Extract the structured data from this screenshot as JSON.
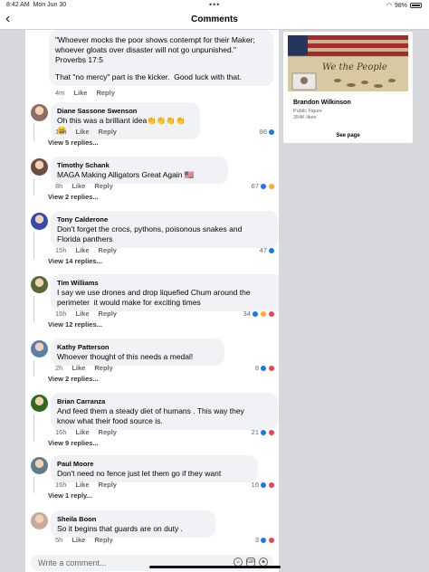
{
  "status_bar": {
    "time": "8:42 AM",
    "date": "Mon Jun 30",
    "battery": "98%"
  },
  "header": {
    "title": "Comments",
    "back_icon": "chevron-left-icon"
  },
  "top_comment": {
    "lines": [
      "\"Whoever mocks the poor shows contempt for their Maker;",
      "whoever gloats over disaster will not go unpunished.\"",
      "Proverbs 17:5",
      "",
      "That \"no mercy\" part is the kicker.  Good luck with that."
    ],
    "time": "4m",
    "like": "Like",
    "reply": "Reply"
  },
  "comments": [
    {
      "author": "Diane Sassone Swenson",
      "text": "Oh this was a brilliant idea👏👏👏👏😀",
      "time": "17h",
      "like": "Like",
      "reply": "Reply",
      "count": "86",
      "reactions": [
        "like"
      ],
      "replies": "View 5 replies...",
      "avatar_color": "#8d6e63"
    },
    {
      "author": "Timothy Schank",
      "text": "MAGA Making Alligators Great Again 🇺🇸",
      "time": "8h",
      "like": "Like",
      "reply": "Reply",
      "count": "67",
      "reactions": [
        "like",
        "haha"
      ],
      "replies": "View 2 replies...",
      "avatar_color": "#6d4c41"
    },
    {
      "author": "Tony Calderone",
      "text": "Don't forget the crocs, pythons, poisonous snakes and\nFlorida panthers",
      "time": "15h",
      "like": "Like",
      "reply": "Reply",
      "count": "47",
      "reactions": [
        "like"
      ],
      "replies": "View 14 replies...",
      "avatar_color": "#3949ab"
    },
    {
      "author": "Tim Williams",
      "text": "I say we use drones and drop liquefied Chum around the\nperimeter  it would make for exciting times",
      "time": "16h",
      "like": "Like",
      "reply": "Reply",
      "count": "34",
      "reactions": [
        "like",
        "haha",
        "love"
      ],
      "replies": "View 12 replies...",
      "avatar_color": "#556b2f"
    },
    {
      "author": "Kathy Patterson",
      "text": "Whoever thought of this needs a medal!",
      "time": "2h",
      "like": "Like",
      "reply": "Reply",
      "count": "8",
      "reactions": [
        "like",
        "love"
      ],
      "replies": "View 2 replies...",
      "avatar_color": "#5c7fa8"
    },
    {
      "author": "Brian Carranza",
      "text": "And feed them a steady diet of humans . This way they\nknow what their food source is.",
      "time": "16h",
      "like": "Like",
      "reply": "Reply",
      "count": "21",
      "reactions": [
        "like",
        "love"
      ],
      "replies": "View 9 replies...",
      "avatar_color": "#33691e"
    },
    {
      "author": "Paul Moore",
      "text": "Don't need no fence just let them go if they want",
      "time": "16h",
      "like": "Like",
      "reply": "Reply",
      "count": "16",
      "reactions": [
        "like",
        "love"
      ],
      "replies": "View 1 reply...",
      "avatar_color": "#607d8b"
    },
    {
      "author": "Sheila Boon",
      "text": "So it begins that guards are on duty .",
      "time": "5h",
      "like": "Like",
      "reply": "Reply",
      "count": "3",
      "reactions": [
        "like",
        "love"
      ],
      "replies": "",
      "avatar_color": "#c9a99a"
    }
  ],
  "write_comment": {
    "placeholder": "Write a comment..."
  },
  "ad": {
    "name": "Brandon Wilkinson",
    "category": "Public Figure",
    "likes": "354K likes",
    "see_page": "See page",
    "image_text": "We the People"
  },
  "colors": {
    "link": "#65676b",
    "like": "#1877f2",
    "love": "#f33e58",
    "haha": "#f7b125",
    "bubble": "#f0f2f5"
  }
}
